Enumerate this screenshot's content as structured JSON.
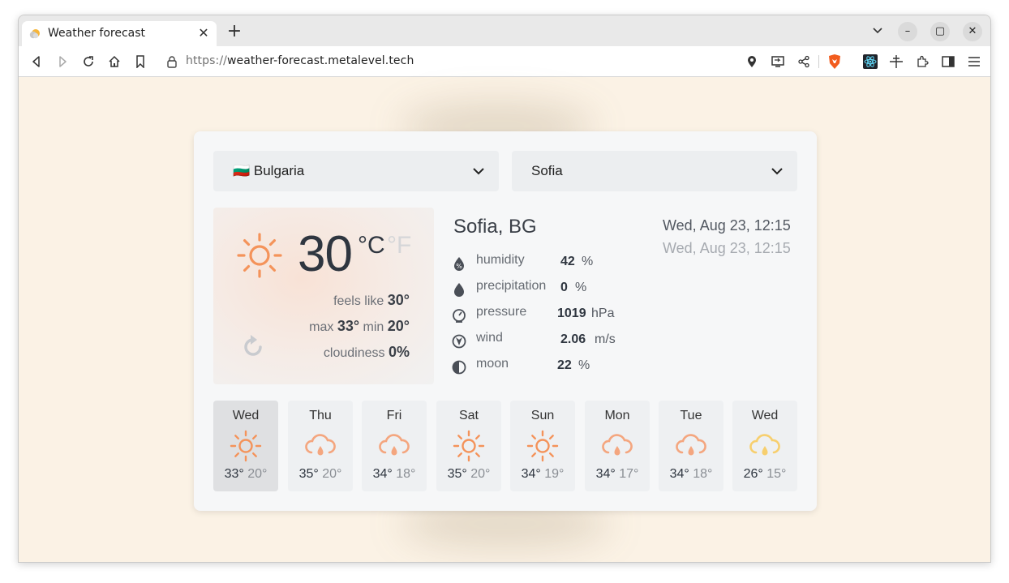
{
  "browser": {
    "tab_title": "Weather forecast",
    "url_protocol": "https://",
    "url_host": "weather-forecast.metalevel.tech",
    "icons": [
      "back-icon",
      "forward-icon",
      "reload-icon",
      "home-icon",
      "bookmark-icon",
      "lock-icon",
      "location-icon",
      "cast-icon",
      "share-icon",
      "brave-shield-icon",
      "react-devtools-icon",
      "move-icon",
      "extensions-icon",
      "sidebar-icon",
      "menu-icon"
    ]
  },
  "selectors": {
    "country": "🇧🇬 Bulgaria",
    "city": "Sofia"
  },
  "current": {
    "temperature": "30",
    "unit_c": "°C",
    "unit_f": "°F",
    "feels_like_label": "feels like",
    "feels_like_value": "30°",
    "max_label": "max",
    "max_value": "33°",
    "min_label": "min",
    "min_value": "20°",
    "cloudiness_label": "cloudiness",
    "cloudiness_value": "0%"
  },
  "location": {
    "city_title": "Sofia, BG",
    "date_primary": "Wed, Aug 23, 12:15",
    "date_secondary": "Wed, Aug 23, 12:15"
  },
  "details": [
    {
      "label": "humidity",
      "value": "42",
      "unit": "%",
      "icon": "humidity-icon"
    },
    {
      "label": "precipitation",
      "value": "0",
      "unit": "%",
      "icon": "drop-icon"
    },
    {
      "label": "pressure",
      "value": "1019",
      "unit": "hPa",
      "icon": "gauge-icon"
    },
    {
      "label": "wind",
      "value": "2.06",
      "unit": "m/s",
      "icon": "wind-direction-icon"
    },
    {
      "label": "moon",
      "value": "22",
      "unit": "%",
      "icon": "moon-icon"
    }
  ],
  "forecast": [
    {
      "day": "Wed",
      "max": "33°",
      "min": "20°",
      "icon": "sun-icon"
    },
    {
      "day": "Thu",
      "max": "35°",
      "min": "20°",
      "icon": "cloud-rain-icon"
    },
    {
      "day": "Fri",
      "max": "34°",
      "min": "18°",
      "icon": "cloud-rain-icon"
    },
    {
      "day": "Sat",
      "max": "35°",
      "min": "20°",
      "icon": "sun-icon"
    },
    {
      "day": "Sun",
      "max": "34°",
      "min": "19°",
      "icon": "sun-icon"
    },
    {
      "day": "Mon",
      "max": "34°",
      "min": "17°",
      "icon": "cloud-rain-icon"
    },
    {
      "day": "Tue",
      "max": "34°",
      "min": "18°",
      "icon": "cloud-rain-icon"
    },
    {
      "day": "Wed",
      "max": "26°",
      "min": "15°",
      "icon": "cloud-rain-icon"
    }
  ],
  "colors": {
    "sun": "#f4935a",
    "cloud_rain": "#f4a67f",
    "cloud_rain_alt": "#f7cf6e",
    "page_bg": "#fbf2e5"
  }
}
